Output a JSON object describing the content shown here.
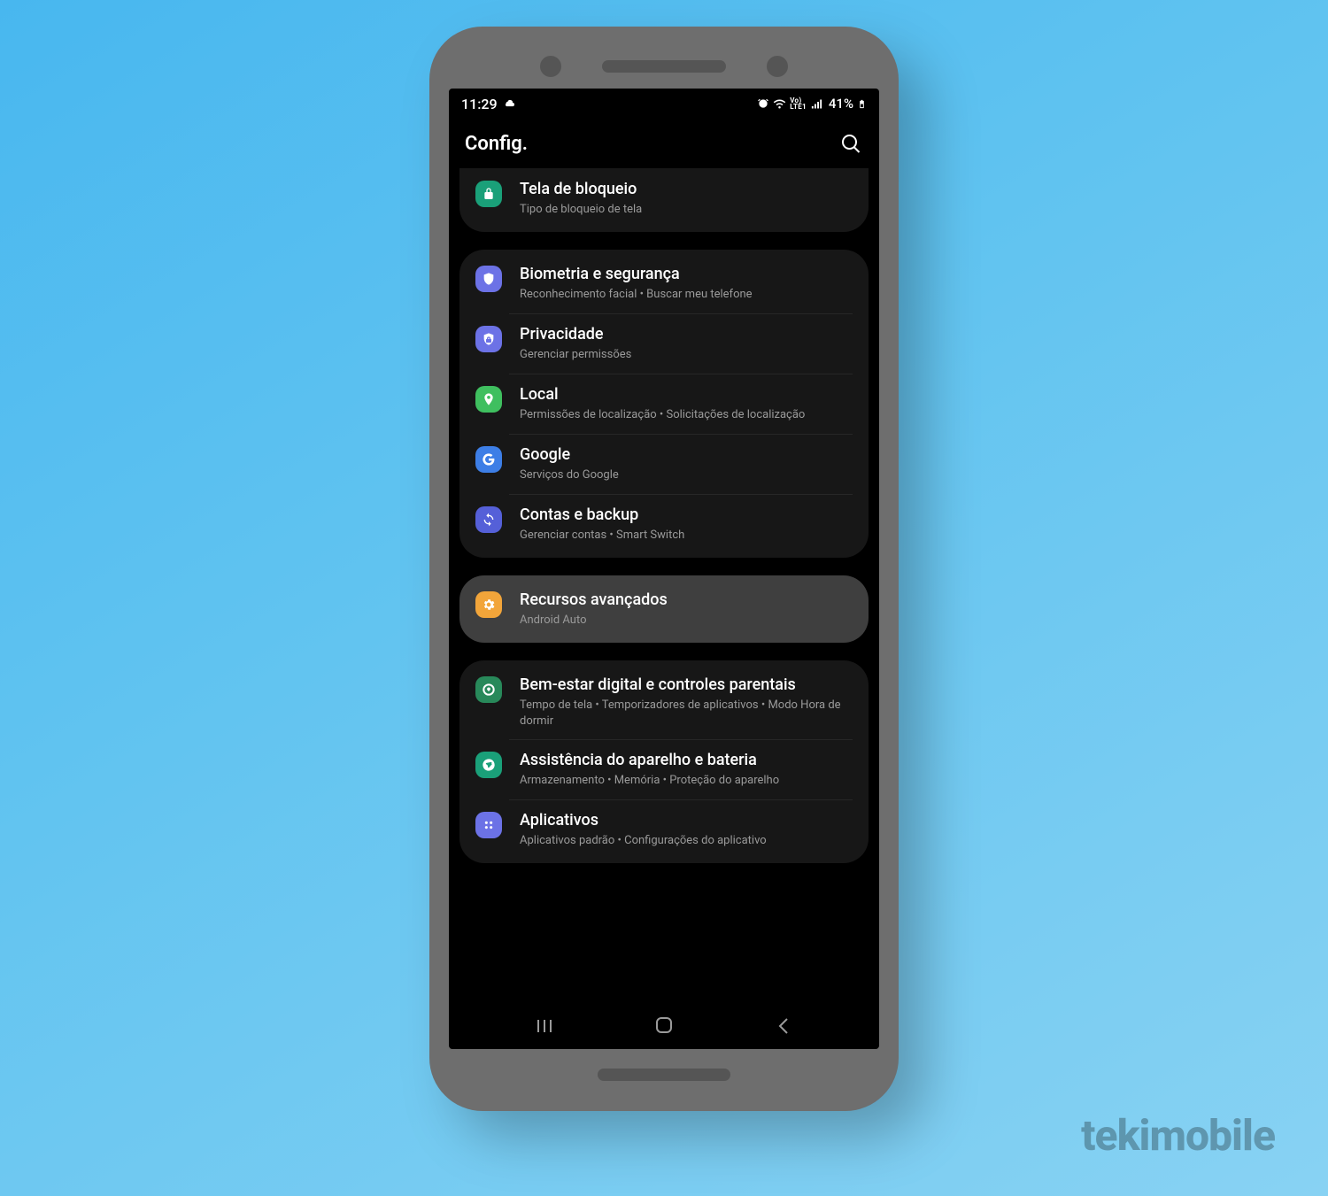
{
  "watermark": "tekimobile",
  "status_bar": {
    "time": "11:29",
    "battery": "41%",
    "net_label": "Vo)\nLTE1"
  },
  "header": {
    "title": "Config."
  },
  "groups": [
    {
      "style": "first",
      "items": [
        {
          "icon": "lock",
          "icon_bg": "#1aa079",
          "title": "Tela de bloqueio",
          "subtitle": "Tipo de bloqueio de tela"
        }
      ]
    },
    {
      "style": "",
      "items": [
        {
          "icon": "shield",
          "icon_bg": "#6c72e6",
          "title": "Biometria e segurança",
          "subtitle": "Reconhecimento facial  •  Buscar meu telefone"
        },
        {
          "icon": "privacy",
          "icon_bg": "#6c72e6",
          "title": "Privacidade",
          "subtitle": "Gerenciar permissões"
        },
        {
          "icon": "pin",
          "icon_bg": "#3fbf5f",
          "title": "Local",
          "subtitle": "Permissões de localização  •  Solicitações de localização"
        },
        {
          "icon": "google",
          "icon_bg": "#3d7ee6",
          "title": "Google",
          "subtitle": "Serviços do Google"
        },
        {
          "icon": "sync",
          "icon_bg": "#5560d8",
          "title": "Contas e backup",
          "subtitle": "Gerenciar contas  •  Smart Switch"
        }
      ]
    },
    {
      "style": "highlight",
      "items": [
        {
          "icon": "gear-badge",
          "icon_bg": "#f2a53a",
          "title": "Recursos avançados",
          "subtitle": "Android Auto"
        }
      ]
    },
    {
      "style": "",
      "items": [
        {
          "icon": "wellbeing",
          "icon_bg": "#28895a",
          "title": "Bem-estar digital e controles parentais",
          "subtitle": "Tempo de tela  •  Temporizadores de aplicativos  •  Modo Hora de dormir"
        },
        {
          "icon": "care",
          "icon_bg": "#1aa079",
          "title": "Assistência do aparelho e bateria",
          "subtitle": "Armazenamento  •  Memória  •  Proteção do aparelho"
        },
        {
          "icon": "apps",
          "icon_bg": "#6c72e6",
          "title": "Aplicativos",
          "subtitle": "Aplicativos padrão  •  Configurações do aplicativo"
        }
      ]
    }
  ]
}
